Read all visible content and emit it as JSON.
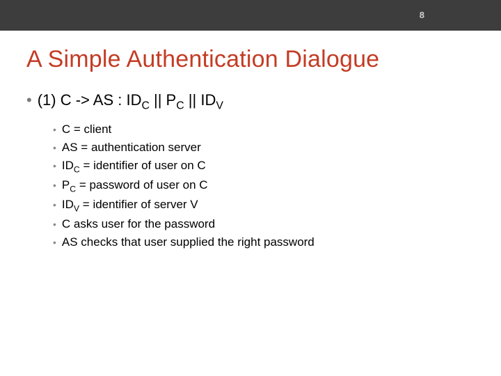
{
  "slide_number": "8",
  "title": "A Simple Authentication Dialogue",
  "main_prefix": "(1) C -> AS : ID",
  "main_sub1": "C",
  "main_sep1": " || P",
  "main_sub2": "C",
  "main_sep2": " || ID",
  "main_sub3": "V",
  "sub": {
    "l1": "C = client",
    "l2": "AS = authentication server",
    "l3_a": "ID",
    "l3_sub": "C",
    "l3_b": " = identifier of user on C",
    "l4_a": "P",
    "l4_sub": "C",
    "l4_b": " = password of user on C",
    "l5_a": "ID",
    "l5_sub": "V",
    "l5_b": " = identifier of server V",
    "l6": "C asks user for the password",
    "l7": "AS checks that user supplied the right password"
  }
}
